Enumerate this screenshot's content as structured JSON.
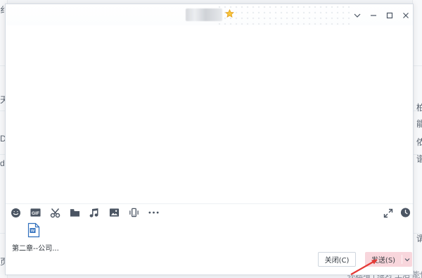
{
  "window": {
    "contact_name": "",
    "bottom_background_text": "标题增 | 维对 生活 能停"
  },
  "title_icons": {
    "favorite": "star-icon"
  },
  "window_controls": [
    {
      "name": "chevron-down-icon"
    },
    {
      "name": "minimize-icon"
    },
    {
      "name": "maximize-icon"
    },
    {
      "name": "close-icon"
    }
  ],
  "call_actions": [
    {
      "name": "voice-call-icon"
    },
    {
      "name": "video-call-icon"
    },
    {
      "name": "more-icon"
    }
  ],
  "toolbar": {
    "items": [
      {
        "name": "emoji-icon"
      },
      {
        "name": "gif-icon",
        "text": "GIF"
      },
      {
        "name": "scissors-icon"
      },
      {
        "name": "folder-icon"
      },
      {
        "name": "music-icon"
      },
      {
        "name": "image-icon"
      },
      {
        "name": "screen-share-icon"
      },
      {
        "name": "more-icon"
      }
    ],
    "right_items": [
      {
        "name": "expand-icon"
      },
      {
        "name": "history-icon"
      }
    ]
  },
  "attachment": {
    "file_name": "第二章--公司...",
    "file_type": "W"
  },
  "buttons": {
    "close_label": "关闭(C)",
    "send_label": "发送(S)"
  },
  "colors": {
    "accent": "#e73c50",
    "send_background": "#f8d6dc",
    "icon_gray": "#4b5563",
    "window_border": "#d5dbe3"
  },
  "background": {
    "left_letters": [
      "纟",
      "天",
      "D",
      "d",
      "页"
    ],
    "right_letters": [
      "柏",
      "能",
      "侬",
      "谱",
      "谓"
    ]
  }
}
